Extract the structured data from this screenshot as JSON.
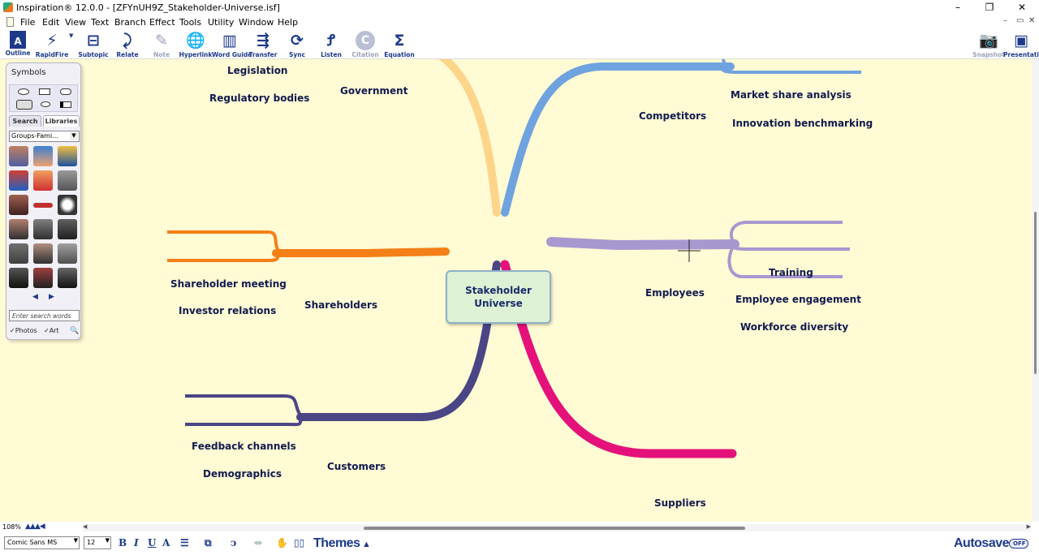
{
  "window": {
    "title": "Inspiration® 12.0.0 - [ZFYnUH9Z_Stakeholder-Universe.isf]",
    "controls": {
      "minimize": "–",
      "restore": "❐",
      "close": "✕"
    },
    "doc_controls": {
      "minimize": "–",
      "restore": "▭",
      "close": "✕"
    }
  },
  "menu": [
    "File",
    "Edit",
    "View",
    "Text",
    "Branch",
    "Effect",
    "Tools",
    "Utility",
    "Window",
    "Help"
  ],
  "toolbar": {
    "outline": "Outline",
    "rapidfire": "RapidFire",
    "subtopic": "Subtopic",
    "relate": "Relate",
    "note": "Note",
    "hyperlink": "Hyperlink",
    "word_guide": "Word Guide",
    "transfer": "Transfer",
    "sync": "Sync",
    "listen": "Listen",
    "citation": "Citation",
    "equation": "Equation",
    "snapshot": "Snapshot",
    "presentation": "Presentation"
  },
  "map": {
    "center": {
      "line1": "Stakeholder",
      "line2": "Universe"
    },
    "government": {
      "label": "Government",
      "children": [
        "Legislation",
        "Regulatory bodies"
      ],
      "color": "#fdd58a"
    },
    "competitors": {
      "label": "Competitors",
      "children": [
        "Market share analysis",
        "Innovation benchmarking"
      ],
      "color": "#6fa3df"
    },
    "shareholders": {
      "label": "Shareholders",
      "children": [
        "Shareholder meeting",
        "Investor relations"
      ],
      "color": "#f47f16"
    },
    "employees": {
      "label": "Employees",
      "children": [
        "Training",
        "Employee engagement",
        "Workforce diversity"
      ],
      "color": "#a898d0"
    },
    "customers": {
      "label": "Customers",
      "children": [
        "Feedback channels",
        "Demographics"
      ],
      "color": "#4a4585"
    },
    "suppliers": {
      "label": "Suppliers",
      "children": [],
      "color": "#e4117a"
    }
  },
  "symbols_panel": {
    "title": "Symbols",
    "tabs": [
      "Search",
      "Libraries"
    ],
    "active_tab": "Libraries",
    "library": "Groups-Fami...",
    "search_placeholder": "Enter search words",
    "photos_label": "Photos",
    "art_label": "Art",
    "photos_checked": true,
    "art_checked": true
  },
  "status": {
    "zoom": "108%"
  },
  "format_bar": {
    "font": "Comic Sans MS",
    "size": "12",
    "bold": "B",
    "italic": "I",
    "underline": "U",
    "themes": "Themes",
    "autosave": "Autosave",
    "autosave_state": "OFF"
  }
}
